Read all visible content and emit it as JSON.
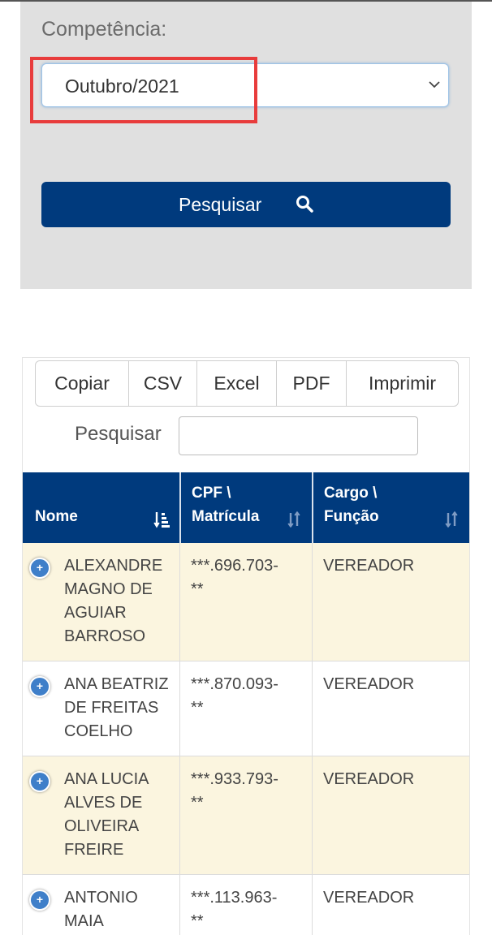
{
  "filter": {
    "label": "Competência:",
    "selected": "Outubro/2021",
    "search_button": "Pesquisar"
  },
  "toolbar": {
    "buttons": [
      "Copiar",
      "CSV",
      "Excel",
      "PDF",
      "Imprimir"
    ],
    "search_label": "Pesquisar",
    "search_value": ""
  },
  "table": {
    "headers": [
      {
        "lines": [
          "Nome"
        ],
        "sort_icon": "sort-amount-down-icon"
      },
      {
        "lines": [
          "CPF \\",
          "Matrícula"
        ],
        "sort_icon": "sort-both-icon"
      },
      {
        "lines": [
          "Cargo \\",
          "Função"
        ],
        "sort_icon": "sort-both-icon"
      }
    ],
    "rows": [
      {
        "name": [
          "ALEXANDRE",
          "MAGNO DE",
          "AGUIAR",
          "BARROSO"
        ],
        "cpf": [
          "***.696.703-",
          "**"
        ],
        "cargo": [
          "VEREADOR"
        ]
      },
      {
        "name": [
          "ANA BEATRIZ",
          "DE FREITAS",
          "COELHO"
        ],
        "cpf": [
          "***.870.093-",
          "**"
        ],
        "cargo": [
          "VEREADOR"
        ]
      },
      {
        "name": [
          "ANA LUCIA",
          "ALVES DE",
          "OLIVEIRA",
          "FREIRE"
        ],
        "cpf": [
          "***.933.793-",
          "**"
        ],
        "cargo": [
          "VEREADOR"
        ]
      },
      {
        "name": [
          "ANTONIO",
          "MAIA"
        ],
        "cpf": [
          "***.113.963-",
          "**"
        ],
        "cargo": [
          "VEREADOR"
        ]
      }
    ]
  },
  "colors": {
    "primary": "#003a7d",
    "row_odd": "#fbf5df",
    "panel": "#e0e0e0",
    "highlight": "#e83c3c"
  }
}
